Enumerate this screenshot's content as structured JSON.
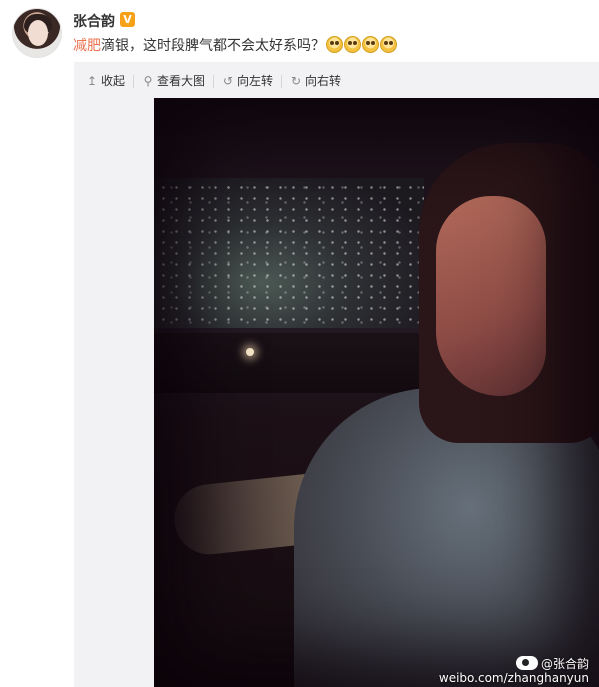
{
  "user": {
    "name": "张合韵",
    "verified_badge": "V"
  },
  "post": {
    "topic": "减肥",
    "text": "滴银，这时段脾气都不会太好系吗？",
    "emoji_count": 4
  },
  "toolbar": {
    "collapse": "收起",
    "view_large": "查看大图",
    "rotate_left": "向左转",
    "rotate_right": "向右转"
  },
  "watermark": {
    "handle": "@张合韵",
    "url": "weibo.com/zhanghanyun"
  },
  "colors": {
    "topic": "#eb7350",
    "verified": "#f7a119",
    "media_bg": "#f2f2f5"
  }
}
